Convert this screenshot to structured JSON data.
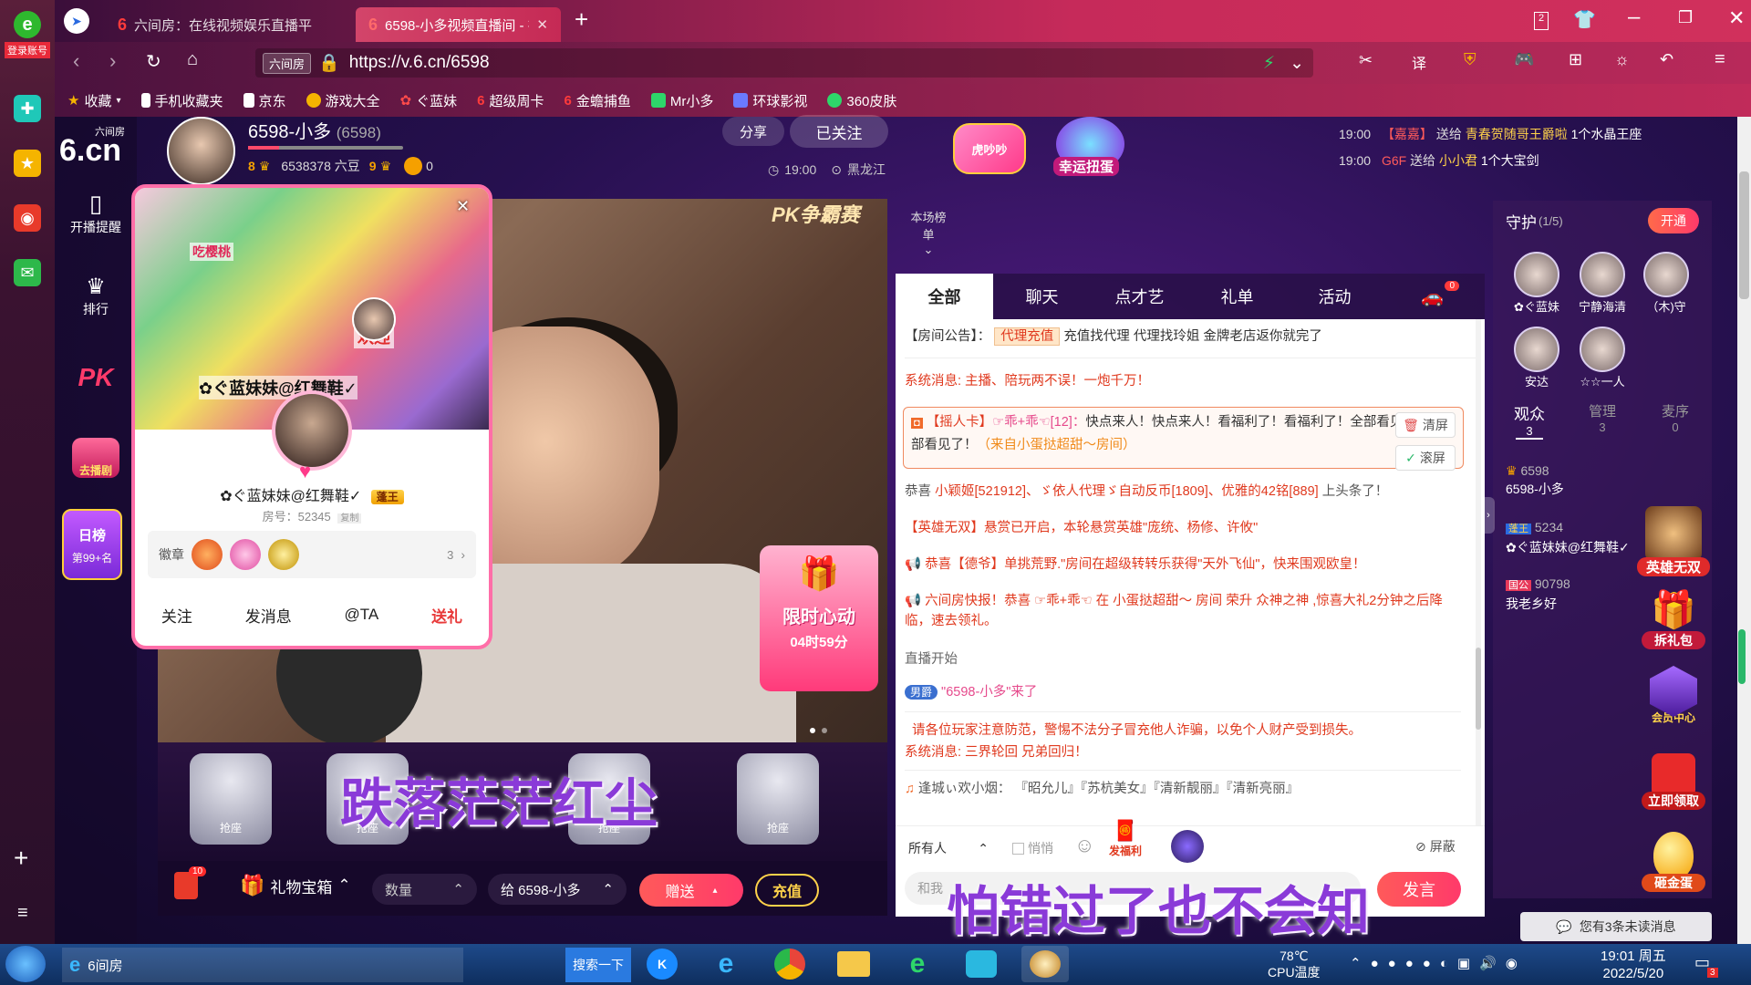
{
  "browser": {
    "sidebar_login": "登录账号",
    "tabs": [
      {
        "label": "六间房：在线视频娱乐直播平"
      },
      {
        "label": "6598-小多视频直播间 - 在线"
      }
    ],
    "tab_count": "2",
    "url_tag": "六间房",
    "url": "https://v.6.cn/6598",
    "bookmarks": [
      "收藏",
      "手机收藏夹",
      "京东",
      "游戏大全",
      "ぐ蓝妹",
      "超级周卡",
      "金蟾捕鱼",
      "Mr小多",
      "环球影视",
      "360皮肤"
    ]
  },
  "site": {
    "logo_sub": "六间房",
    "logo": "6.cn",
    "nav": [
      {
        "label": "开播提醒"
      },
      {
        "label": "排行"
      },
      {
        "label": "PK"
      },
      {
        "label": "去播剧"
      }
    ],
    "rank_badge": {
      "title": "日榜",
      "value": "第99+名"
    }
  },
  "host": {
    "name": "6598-小多",
    "room_id": "(6598)",
    "level_left": "8",
    "beans": "6538378 六豆",
    "level_right": "9",
    "fans": "0",
    "share": "分享",
    "followed": "已关注",
    "time": "19:00",
    "location": "黑龙江"
  },
  "top_banner": {
    "badge1": "虎吵吵",
    "badge2": "幸运扭蛋"
  },
  "ticker": [
    {
      "time": "19:00",
      "user": "【嘉嘉】",
      "action": "送给",
      "target": "青春贺随哥王爵啦",
      "item": "1个水晶王座"
    },
    {
      "time": "19:00",
      "user": "G6F",
      "action": "送给",
      "target": "小小君",
      "item": "1个大宝剑"
    }
  ],
  "video": {
    "watermark": "PK争霸赛",
    "promo_title": "限时心动",
    "promo_timer": "04时59分"
  },
  "seats": {
    "label": "抢座",
    "overlay_lyric": "跌落茫茫红尘"
  },
  "giftbar": {
    "gift_count": "10",
    "gift_box": "礼物宝箱",
    "qty": "数量",
    "to": "给 6598-小多",
    "send": "赠送",
    "recharge": "充值"
  },
  "chat": {
    "rank_label": "本场榜单",
    "tabs": [
      "全部",
      "聊天",
      "点才艺",
      "礼单",
      "活动"
    ],
    "car_badge": "0",
    "announce_label": "【房间公告】：",
    "announce_tag": "代理充值",
    "announce_text": "充值找代理 代理找玲姐 金牌老店返你就完了",
    "sys1": "系统消息: 主播、陪玩两不误！一炮千万！",
    "card_tag": "【摇人卡】",
    "card_user": "☞乖+乖☜[12]：",
    "card_text": "快点来人！快点来人！看福利了！看福利了！全部看见了！全部看见了！",
    "card_from": "（来自小蛋挞超甜～房间）",
    "clear": "清屏",
    "scroll": "滚屏",
    "congrats_prefix": "恭喜",
    "congrats_names": "小颖姬[521912]、ゞ依人代理ゞ自动反币[1809]、优雅的42铭[889]",
    "congrats_suffix": "上头条了！",
    "hero": "【英雄无双】悬赏已开启，本轮悬赏英雄\"庞统、杨修、许攸\"",
    "horn": "恭喜【德爷】单挑荒野.\"房间在超级转转乐获得\"天外飞仙\"，快来围观欧皇！",
    "news": "六间房快报！恭喜 ☞乖+乖☜ 在 小蛋挞超甜～ 房间 荣升 众神之神 ,惊喜大礼2分钟之后降临，速去领礼。",
    "live_start": "直播开始",
    "join_badge": "男爵",
    "join_text": "\"6598-小多\"来了",
    "warn": "请各位玩家注意防范，警惕不法分子冒充他人诈骗，以免个人财产受到损失。",
    "sys2": "系统消息: 三界轮回 兄弟回归！",
    "song_user": "逢城ぃ欢小烟：",
    "song_list": "『昭允儿』『苏杭美女』『清新靓丽』『清新亮丽』",
    "target": "所有人",
    "whisper": "悄悄",
    "fuli": "发福利",
    "block": "屏蔽",
    "input_placeholder": "和我",
    "send": "发言",
    "lyric": "怕错过了也不会知"
  },
  "right": {
    "guard_title": "守护",
    "guard_count": "(1/5)",
    "guard_open": "开通",
    "guards": [
      "✿ぐ蓝妹",
      "宁静海清",
      "（木)守",
      "安达",
      "☆☆一人"
    ],
    "tabs": [
      {
        "label": "观众",
        "count": "3"
      },
      {
        "label": "管理",
        "count": "3"
      },
      {
        "label": "麦序",
        "count": "0"
      }
    ],
    "viewers": [
      {
        "level": "6598",
        "name": "6598-小多"
      },
      {
        "badge": "蓬王",
        "level": "5234",
        "name": "✿ぐ蓝妹妹@红舞鞋✓"
      },
      {
        "badge": "国公",
        "level": "90798",
        "name": "我老乡好"
      }
    ],
    "promos": [
      "英雄无双",
      "拆礼包",
      "会员中心",
      "立即领取",
      "砸金蛋"
    ],
    "unread": "您有3条未读消息"
  },
  "popup": {
    "name": "✿ぐ蓝妹妹@红舞鞋✓",
    "title_badge": "蓬王",
    "room": "房号：52345",
    "copy": "复制",
    "badges_label": "徽章",
    "badges_count": "3",
    "actions": [
      "关注",
      "发消息",
      "@TA",
      "送礼"
    ],
    "bg_text1": "吃樱桃",
    "bg_text2": "✿ぐ蓝妹妹@红舞鞋✓",
    "bg_text3": "欢迎"
  },
  "taskbar": {
    "window": "6间房",
    "search": "搜索一下",
    "temp": "78℃",
    "temp_label": "CPU温度",
    "time": "19:01 周五",
    "date": "2022/5/20",
    "notif": "3"
  }
}
